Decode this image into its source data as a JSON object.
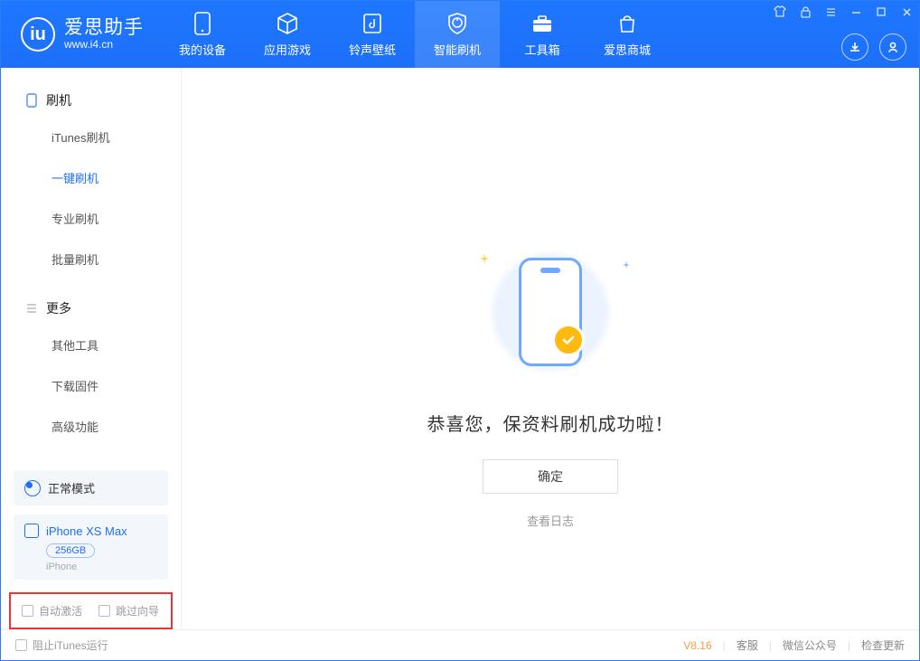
{
  "app": {
    "name": "爱思助手",
    "domain": "www.i4.cn"
  },
  "nav": {
    "items": [
      {
        "label": "我的设备"
      },
      {
        "label": "应用游戏"
      },
      {
        "label": "铃声壁纸"
      },
      {
        "label": "智能刷机"
      },
      {
        "label": "工具箱"
      },
      {
        "label": "爱思商城"
      }
    ],
    "selected_index": 3
  },
  "sidebar": {
    "sections": [
      {
        "title": "刷机",
        "icon": "phone-icon",
        "items": [
          "iTunes刷机",
          "一键刷机",
          "专业刷机",
          "批量刷机"
        ],
        "active_index": 1
      },
      {
        "title": "更多",
        "icon": "menu-icon",
        "items": [
          "其他工具",
          "下载固件",
          "高级功能"
        ],
        "active_index": -1
      }
    ],
    "mode_label": "正常模式",
    "device": {
      "name": "iPhone XS Max",
      "capacity": "256GB",
      "type": "iPhone"
    },
    "checkbox_auto_activate": "自动激活",
    "checkbox_skip_guide": "跳过向导"
  },
  "main": {
    "success_message": "恭喜您，保资料刷机成功啦！",
    "ok_button": "确定",
    "view_log": "查看日志"
  },
  "footer": {
    "block_itunes": "阻止iTunes运行",
    "version": "V8.16",
    "support": "客服",
    "wechat": "微信公众号",
    "check_update": "检查更新"
  }
}
